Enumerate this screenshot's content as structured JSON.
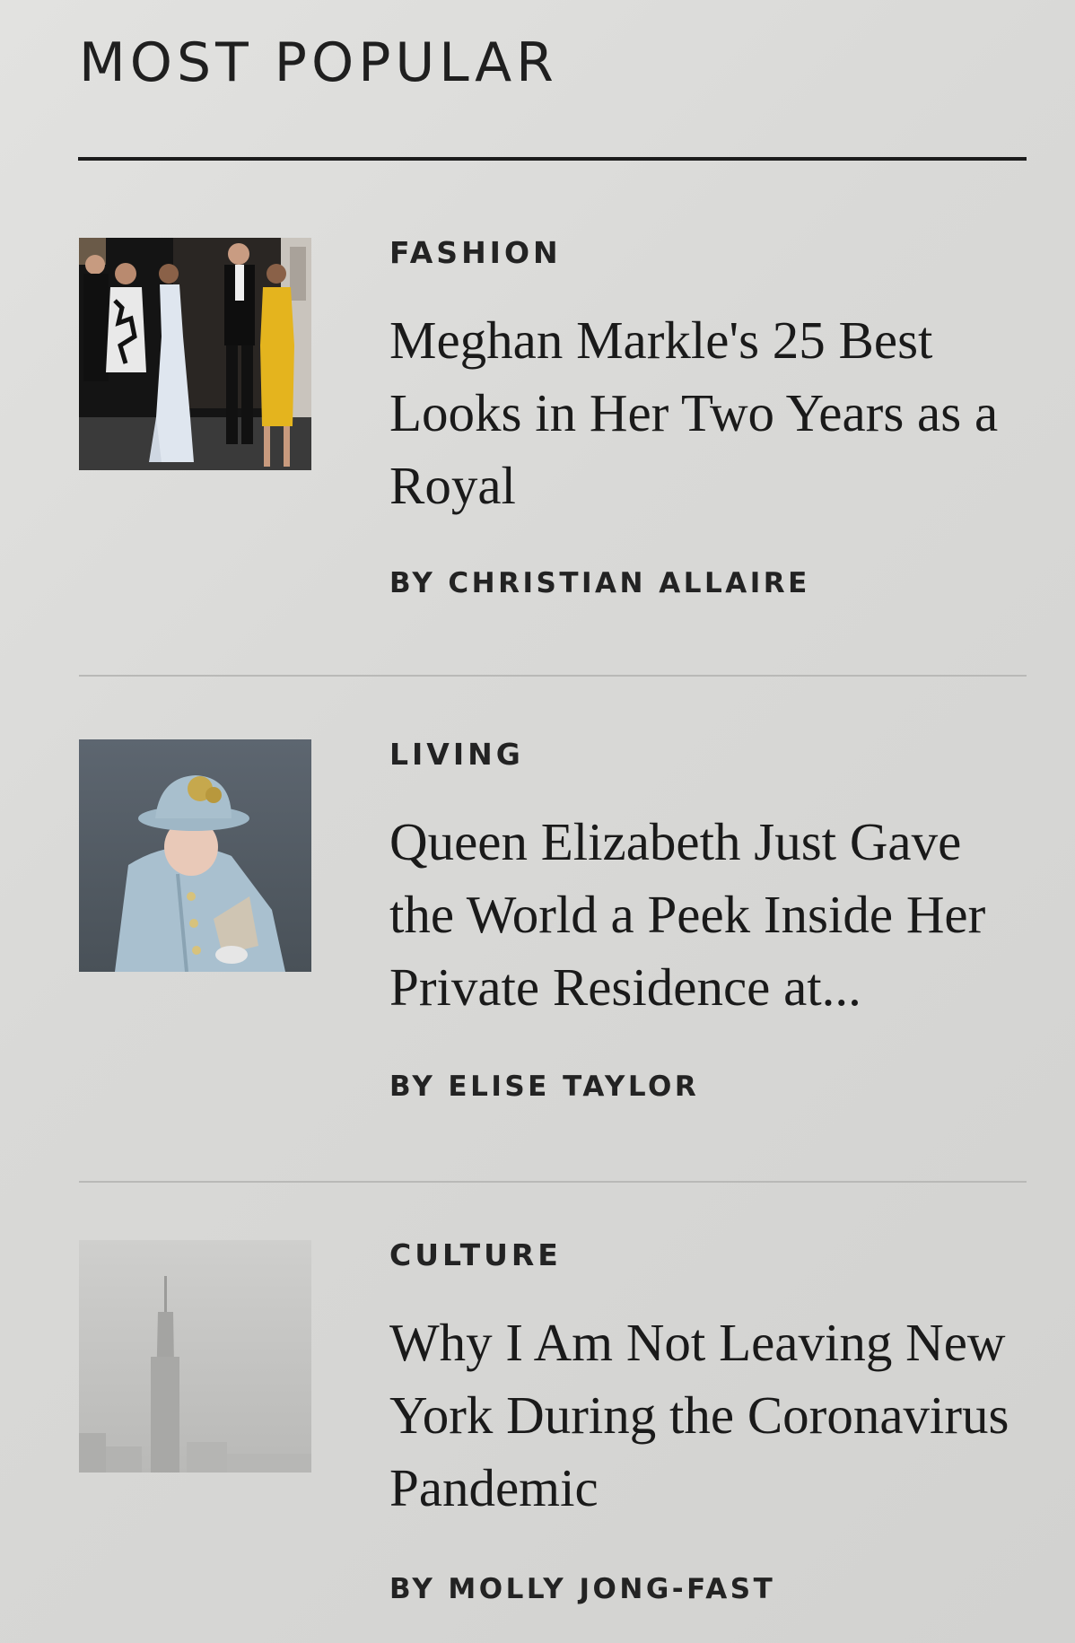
{
  "section": {
    "title": "MOST POPULAR"
  },
  "articles": [
    {
      "category": "FASHION",
      "headline": "Meghan Markle's 25 Best Looks in Her Two Years as a Royal",
      "byline_prefix": "BY",
      "author": "CHRISTIAN ALLAIRE",
      "image": "photo-couples-formal-wear"
    },
    {
      "category": "LIVING",
      "headline": "Queen Elizabeth Just Gave the World a Peek Inside Her Private Residence at...",
      "byline_prefix": "BY",
      "author": "ELISE TAYLOR",
      "image": "photo-woman-blue-hat"
    },
    {
      "category": "CULTURE",
      "headline": "Why I Am Not Leaving New York During the Coronavirus Pandemic",
      "byline_prefix": "BY",
      "author": "MOLLY JONG-FAST",
      "image": "photo-foggy-skyline"
    }
  ],
  "colors": {
    "background": "#dcdcda",
    "text": "#1a1a1a",
    "rule": "#1c1c1c",
    "divider": "#b9b9b7"
  }
}
